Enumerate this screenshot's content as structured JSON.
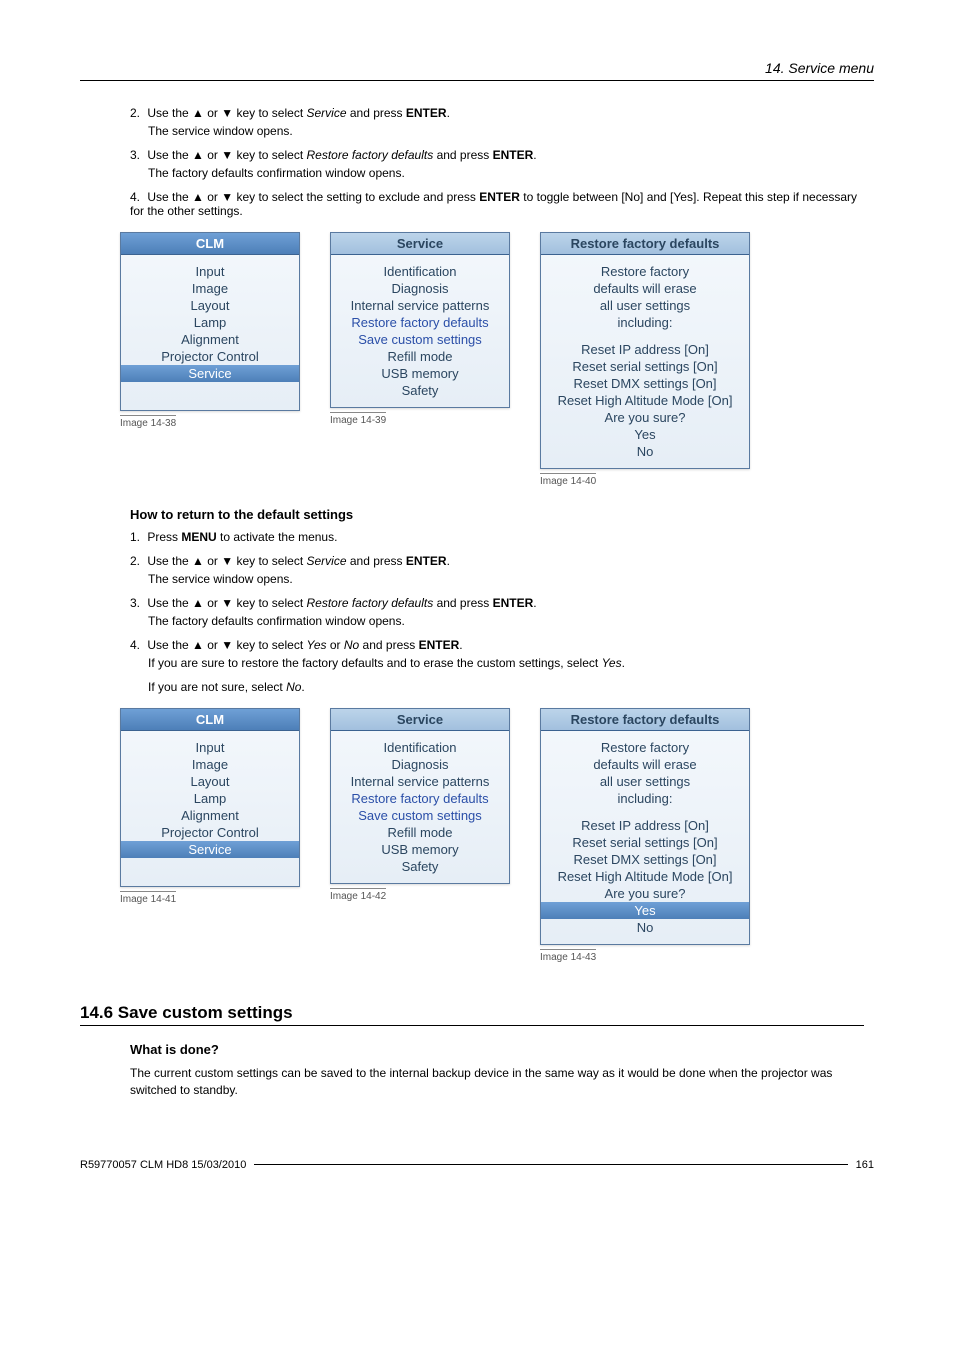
{
  "breadcrumb": "14.  Service menu",
  "steps_a": {
    "s2": {
      "num": "2.",
      "pre": "Use the ▲ or ▼ key to select ",
      "mid": "Service",
      "post": " and press ",
      "btn": "ENTER",
      "end": ".",
      "sub": "The service window opens."
    },
    "s3": {
      "num": "3.",
      "pre": "Use the ▲ or ▼ key to select ",
      "mid": "Restore factory defaults",
      "post": " and press ",
      "btn": "ENTER",
      "end": ".",
      "sub": "The factory defaults confirmation window opens."
    },
    "s4": {
      "num": "4.",
      "text1": "Use the ▲ or ▼ key to select the setting to exclude and press ",
      "btn": "ENTER",
      "text2": " to toggle between [No] and [Yes]. Repeat this step if necessary for the other settings."
    }
  },
  "menus_a": {
    "clm": {
      "title": "CLM",
      "items": [
        "Input",
        "Image",
        "Layout",
        "Lamp",
        "Alignment",
        "Projector Control",
        "Service"
      ],
      "selected": 6,
      "caption": "Image 14-38"
    },
    "service": {
      "title": "Service",
      "items": [
        "Identification",
        "Diagnosis",
        "Internal service patterns",
        "Restore factory defaults",
        "Save custom settings",
        "Refill mode",
        "USB memory",
        "Safety"
      ],
      "blue": [
        3,
        4
      ],
      "caption": "Image 14-39"
    },
    "restore": {
      "title": "Restore factory defaults",
      "lines1": [
        "Restore factory",
        "defaults will erase",
        "all user settings",
        "including:"
      ],
      "lines2": [
        "Reset IP address [On]",
        "Reset serial settings [On]",
        "Reset DMX settings [On]",
        "Reset High Altitude Mode [On]",
        "Are you sure?",
        "Yes",
        "No"
      ],
      "caption": "Image 14-40"
    }
  },
  "subheading_b": "How to return to the default settings",
  "steps_b": {
    "s1": {
      "num": "1.",
      "pre": "Press ",
      "btn": "MENU",
      "post": " to activate the menus."
    },
    "s2": {
      "num": "2.",
      "pre": "Use the ▲ or ▼ key to select ",
      "mid": "Service",
      "post": " and press ",
      "btn": "ENTER",
      "end": ".",
      "sub": "The service window opens."
    },
    "s3": {
      "num": "3.",
      "pre": "Use the ▲ or ▼ key to select ",
      "mid": "Restore factory defaults",
      "post": " and press ",
      "btn": "ENTER",
      "end": ".",
      "sub": "The factory defaults confirmation window opens."
    },
    "s4": {
      "num": "4.",
      "pre": "Use the ▲ or ▼ key to select ",
      "mid": "Yes",
      "or": " or ",
      "mid2": "No",
      "post": " and press ",
      "btn": "ENTER",
      "end": ".",
      "sub1a": "If you are sure to restore the factory defaults and to erase the custom settings, select ",
      "sub1b": "Yes",
      "sub1c": ".",
      "sub2a": "If you are not sure, select ",
      "sub2b": "No",
      "sub2c": "."
    }
  },
  "menus_b": {
    "clm": {
      "caption": "Image 14-41"
    },
    "service": {
      "caption": "Image 14-42"
    },
    "restore": {
      "caption": "Image 14-43",
      "yes_selected": true
    }
  },
  "section": "14.6  Save custom settings",
  "what_heading": "What is done?",
  "what_body": "The current custom settings can be saved to the internal backup device in the same way as it would be done when the projector was switched to standby.",
  "footer": {
    "left": "R59770057  CLM HD8  15/03/2010",
    "page": "161"
  }
}
